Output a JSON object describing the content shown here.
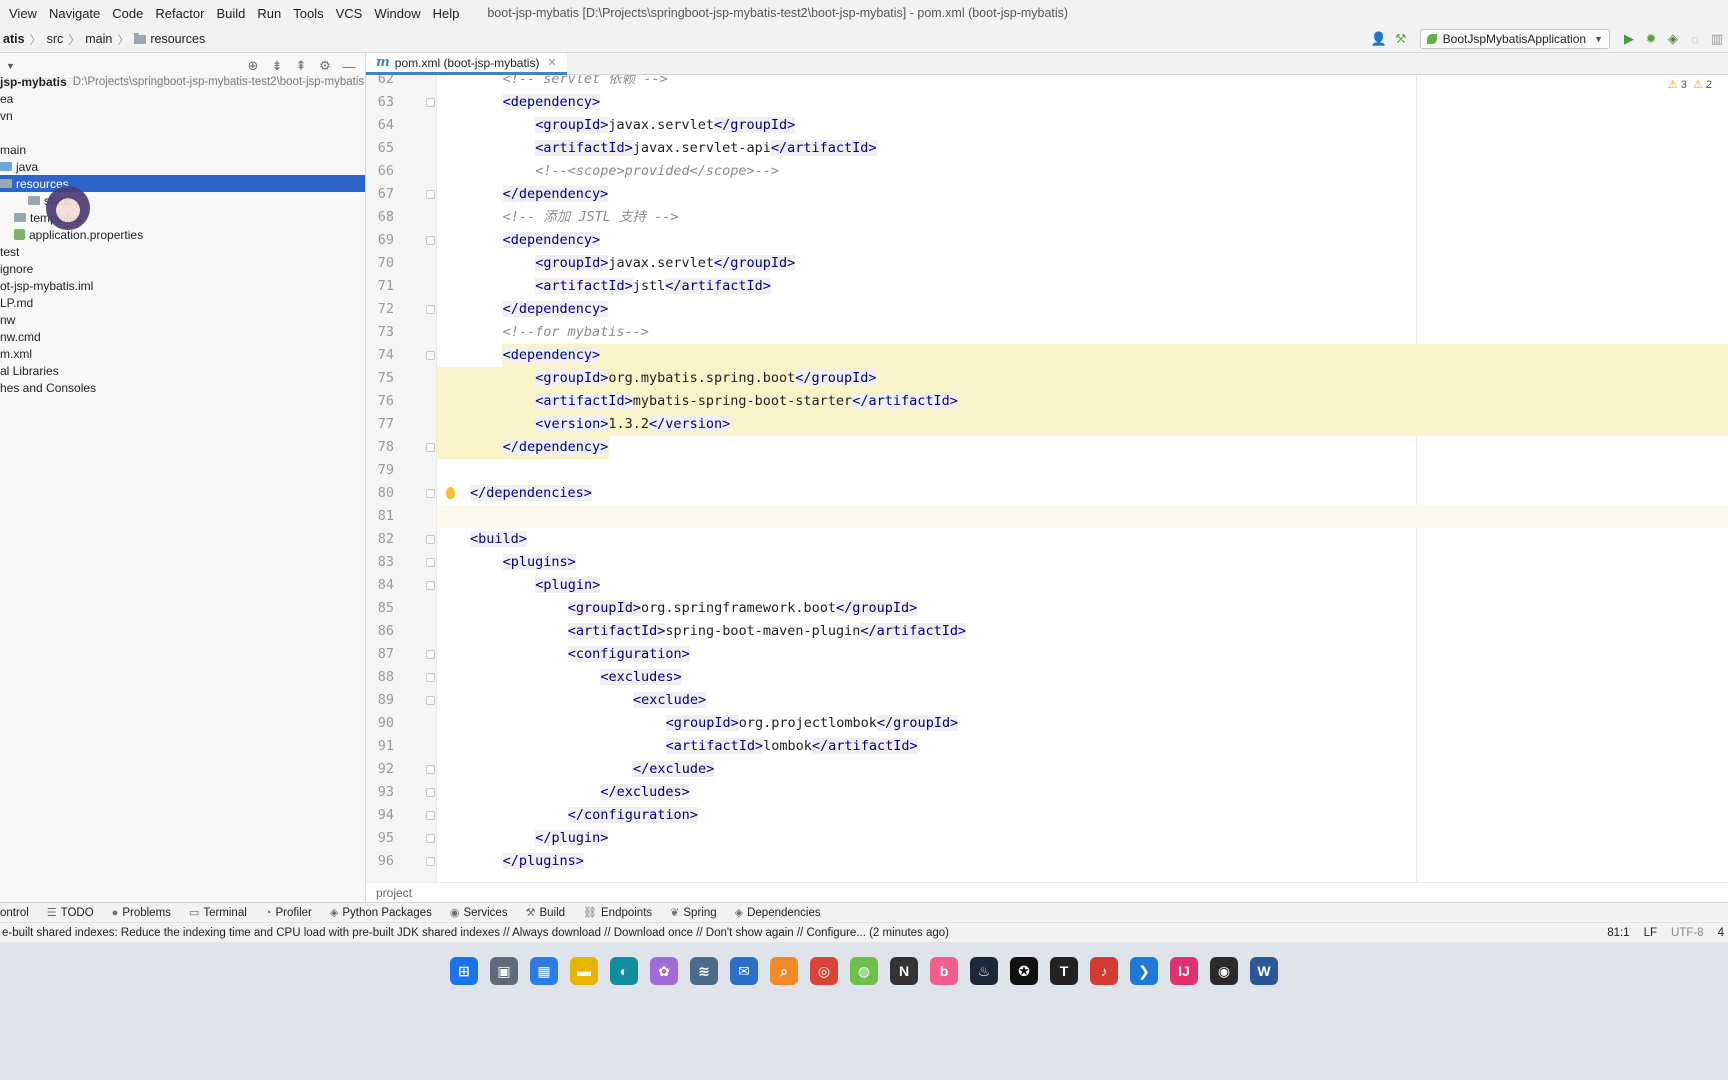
{
  "menu": {
    "items": [
      "View",
      "Navigate",
      "Code",
      "Refactor",
      "Build",
      "Run",
      "Tools",
      "VCS",
      "Window",
      "Help"
    ],
    "window_title": "boot-jsp-mybatis [D:\\Projects\\springboot-jsp-mybatis-test2\\boot-jsp-mybatis] - pom.xml (boot-jsp-mybatis)"
  },
  "breadcrumb": {
    "items": [
      "atis",
      "src",
      "main",
      "resources"
    ]
  },
  "toolbar": {
    "run_config": "BootJspMybatisApplication"
  },
  "project_tree": {
    "root_name": "jsp-mybatis",
    "root_path": "D:\\Projects\\springboot-jsp-mybatis-test2\\boot-jsp-mybatis",
    "rows": [
      {
        "label": "ea",
        "indent": 0,
        "kind": "none"
      },
      {
        "label": "vn",
        "indent": 0,
        "kind": "none"
      },
      {
        "label": "",
        "indent": 0,
        "kind": "none"
      },
      {
        "label": "main",
        "indent": 0,
        "kind": "none"
      },
      {
        "label": "java",
        "indent": 0,
        "kind": "folder-blue"
      },
      {
        "label": "resources",
        "indent": 0,
        "kind": "folder",
        "selected": true
      },
      {
        "label": "static",
        "indent": 28,
        "kind": "folder"
      },
      {
        "label": "templates",
        "indent": 14,
        "kind": "folder"
      },
      {
        "label": "application.properties",
        "indent": 14,
        "kind": "file"
      },
      {
        "label": "test",
        "indent": 0,
        "kind": "none"
      },
      {
        "label": "ignore",
        "indent": 0,
        "kind": "none"
      },
      {
        "label": "ot-jsp-mybatis.iml",
        "indent": 0,
        "kind": "none"
      },
      {
        "label": "LP.md",
        "indent": 0,
        "kind": "none"
      },
      {
        "label": "nw",
        "indent": 0,
        "kind": "none"
      },
      {
        "label": "nw.cmd",
        "indent": 0,
        "kind": "none"
      },
      {
        "label": "m.xml",
        "indent": 0,
        "kind": "none"
      },
      {
        "label": "al Libraries",
        "indent": 0,
        "kind": "none"
      },
      {
        "label": "hes and Consoles",
        "indent": 0,
        "kind": "none"
      }
    ]
  },
  "editor": {
    "tab_label": "pom.xml (boot-jsp-mybatis)",
    "warnings": "3",
    "warnings2": "2",
    "highlight_lines": [
      74,
      75,
      76,
      77,
      78
    ],
    "caret_line": 81,
    "lines": [
      {
        "n": "62",
        "indent": 2,
        "parts": [
          [
            "c",
            "<!-- servlet 依赖 -->"
          ]
        ]
      },
      {
        "n": "63",
        "indent": 2,
        "parts": [
          [
            "t",
            "<dependency>"
          ]
        ],
        "fold": true
      },
      {
        "n": "64",
        "indent": 3,
        "parts": [
          [
            "t",
            "<groupId>"
          ],
          [
            "p",
            "javax.servlet"
          ],
          [
            "t",
            "</groupId>"
          ]
        ]
      },
      {
        "n": "65",
        "indent": 3,
        "parts": [
          [
            "t",
            "<artifactId>"
          ],
          [
            "p",
            "javax.servlet-api"
          ],
          [
            "t",
            "</artifactId>"
          ]
        ]
      },
      {
        "n": "66",
        "indent": 3,
        "parts": [
          [
            "c",
            "<!--<scope>provided</scope>-->"
          ]
        ]
      },
      {
        "n": "67",
        "indent": 2,
        "parts": [
          [
            "t",
            "</dependency>"
          ]
        ],
        "fold": true
      },
      {
        "n": "68",
        "indent": 2,
        "parts": [
          [
            "c",
            "<!-- 添加 JSTL 支持 -->"
          ]
        ]
      },
      {
        "n": "69",
        "indent": 2,
        "parts": [
          [
            "t",
            "<dependency>"
          ]
        ],
        "fold": true
      },
      {
        "n": "70",
        "indent": 3,
        "parts": [
          [
            "t",
            "<groupId>"
          ],
          [
            "p",
            "javax.servlet"
          ],
          [
            "t",
            "</groupId>"
          ]
        ]
      },
      {
        "n": "71",
        "indent": 3,
        "parts": [
          [
            "t",
            "<artifactId>"
          ],
          [
            "p",
            "jstl"
          ],
          [
            "t",
            "</artifactId>"
          ]
        ]
      },
      {
        "n": "72",
        "indent": 2,
        "parts": [
          [
            "t",
            "</dependency>"
          ]
        ],
        "fold": true
      },
      {
        "n": "73",
        "indent": 2,
        "parts": [
          [
            "c",
            "<!--for mybatis-->"
          ]
        ]
      },
      {
        "n": "74",
        "indent": 2,
        "parts": [
          [
            "t",
            "<dependency>"
          ]
        ],
        "fold": true
      },
      {
        "n": "75",
        "indent": 3,
        "parts": [
          [
            "t",
            "<groupId>"
          ],
          [
            "p",
            "org.mybatis.spring.boot"
          ],
          [
            "t",
            "</groupId>"
          ]
        ]
      },
      {
        "n": "76",
        "indent": 3,
        "parts": [
          [
            "t",
            "<artifactId>"
          ],
          [
            "p",
            "mybatis-spring-boot-starter"
          ],
          [
            "t",
            "</artifactId>"
          ]
        ]
      },
      {
        "n": "77",
        "indent": 3,
        "parts": [
          [
            "t",
            "<version>"
          ],
          [
            "p",
            "1.3.2"
          ],
          [
            "t",
            "</version>"
          ]
        ]
      },
      {
        "n": "78",
        "indent": 2,
        "parts": [
          [
            "t",
            "</dependency>"
          ]
        ],
        "fold": true
      },
      {
        "n": "79",
        "indent": 0,
        "parts": []
      },
      {
        "n": "80",
        "indent": 1,
        "parts": [
          [
            "t",
            "</dependencies>"
          ]
        ],
        "fold": true,
        "bulb": true
      },
      {
        "n": "81",
        "indent": 0,
        "parts": []
      },
      {
        "n": "82",
        "indent": 1,
        "parts": [
          [
            "t",
            "<build>"
          ]
        ],
        "fold": true
      },
      {
        "n": "83",
        "indent": 2,
        "parts": [
          [
            "t",
            "<plugins>"
          ]
        ],
        "fold": true
      },
      {
        "n": "84",
        "indent": 3,
        "parts": [
          [
            "t",
            "<plugin>"
          ]
        ],
        "fold": true
      },
      {
        "n": "85",
        "indent": 4,
        "parts": [
          [
            "t",
            "<groupId>"
          ],
          [
            "p",
            "org.springframework.boot"
          ],
          [
            "t",
            "</groupId>"
          ]
        ]
      },
      {
        "n": "86",
        "indent": 4,
        "parts": [
          [
            "t",
            "<artifactId>"
          ],
          [
            "p",
            "spring-boot-maven-plugin"
          ],
          [
            "t",
            "</artifactId>"
          ]
        ]
      },
      {
        "n": "87",
        "indent": 4,
        "parts": [
          [
            "t",
            "<configuration>"
          ]
        ],
        "fold": true
      },
      {
        "n": "88",
        "indent": 5,
        "parts": [
          [
            "t",
            "<excludes>"
          ]
        ],
        "fold": true
      },
      {
        "n": "89",
        "indent": 6,
        "parts": [
          [
            "t",
            "<exclude>"
          ]
        ],
        "fold": true
      },
      {
        "n": "90",
        "indent": 7,
        "parts": [
          [
            "t",
            "<groupId>"
          ],
          [
            "p",
            "org.projectlombok"
          ],
          [
            "t",
            "</groupId>"
          ]
        ]
      },
      {
        "n": "91",
        "indent": 7,
        "parts": [
          [
            "t",
            "<artifactId>"
          ],
          [
            "p",
            "lombok"
          ],
          [
            "t",
            "</artifactId>"
          ]
        ]
      },
      {
        "n": "92",
        "indent": 6,
        "parts": [
          [
            "t",
            "</exclude>"
          ]
        ],
        "fold": true
      },
      {
        "n": "93",
        "indent": 5,
        "parts": [
          [
            "t",
            "</excludes>"
          ]
        ],
        "fold": true
      },
      {
        "n": "94",
        "indent": 4,
        "parts": [
          [
            "t",
            "</configuration>"
          ]
        ],
        "fold": true
      },
      {
        "n": "95",
        "indent": 3,
        "parts": [
          [
            "t",
            "</plugin>"
          ]
        ],
        "fold": true
      },
      {
        "n": "96",
        "indent": 2,
        "parts": [
          [
            "t",
            "</plugins>"
          ]
        ],
        "fold": true
      }
    ]
  },
  "editor_breadcrumb": "project",
  "tool_windows": [
    {
      "label": "ontrol",
      "icon": ""
    },
    {
      "label": "TODO",
      "icon": "☰"
    },
    {
      "label": "Problems",
      "icon": "●"
    },
    {
      "label": "Terminal",
      "icon": "▭"
    },
    {
      "label": "Profiler",
      "icon": "◔"
    },
    {
      "label": "Python Packages",
      "icon": "◈"
    },
    {
      "label": "Services",
      "icon": "◉"
    },
    {
      "label": "Build",
      "icon": "⚒"
    },
    {
      "label": "Endpoints",
      "icon": "⛓"
    },
    {
      "label": "Spring",
      "icon": "❦"
    },
    {
      "label": "Dependencies",
      "icon": "◈"
    }
  ],
  "status": {
    "message": "e-built shared indexes: Reduce the indexing time and CPU load with pre-built JDK shared indexes // Always download // Download once // Don't show again // Configure... (2 minutes ago)",
    "position": "81:1",
    "line_sep": "LF",
    "encoding": "UTF-8",
    "indent": "4"
  },
  "taskbar": {
    "apps": [
      {
        "name": "windows-start-icon",
        "color": "#1a73e8",
        "glyph": "⊞"
      },
      {
        "name": "task-view-icon",
        "color": "#5f6b7a",
        "glyph": "▣"
      },
      {
        "name": "store-icon",
        "color": "#2d7be5",
        "glyph": "▦"
      },
      {
        "name": "file-explorer-icon",
        "color": "#e8b400",
        "glyph": "▬"
      },
      {
        "name": "edge-icon",
        "color": "#0f8f9e",
        "glyph": "◐"
      },
      {
        "name": "photos-icon",
        "color": "#a06bd8",
        "glyph": "✿"
      },
      {
        "name": "monitor-icon",
        "color": "#4b6b8a",
        "glyph": "≋"
      },
      {
        "name": "mail-icon",
        "color": "#2a6fc9",
        "glyph": "✉"
      },
      {
        "name": "search-app-icon",
        "color": "#f08a24",
        "glyph": "⌕"
      },
      {
        "name": "chrome-icon",
        "color": "#db4437",
        "glyph": "◎"
      },
      {
        "name": "app-green-icon",
        "color": "#6cc04a",
        "glyph": "◍"
      },
      {
        "name": "notion-icon",
        "color": "#333333",
        "glyph": "N"
      },
      {
        "name": "bilibili-icon",
        "color": "#f25d8e",
        "glyph": "b"
      },
      {
        "name": "steam-icon",
        "color": "#1b2838",
        "glyph": "♨"
      },
      {
        "name": "qq-icon",
        "color": "#111111",
        "glyph": "✪"
      },
      {
        "name": "typora-icon",
        "color": "#222222",
        "glyph": "T"
      },
      {
        "name": "netease-music-icon",
        "color": "#d43c33",
        "glyph": "♪"
      },
      {
        "name": "vscode-icon",
        "color": "#1e7ad6",
        "glyph": "❯"
      },
      {
        "name": "intellij-icon",
        "color": "#e0316f",
        "glyph": "IJ"
      },
      {
        "name": "obs-icon",
        "color": "#2b2b2b",
        "glyph": "◉"
      },
      {
        "name": "word-icon",
        "color": "#2b5797",
        "glyph": "W"
      }
    ]
  }
}
